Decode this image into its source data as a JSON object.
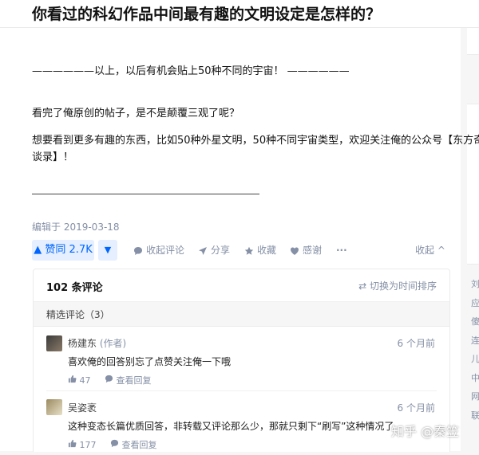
{
  "question": {
    "title": "你看过的科幻作品中间最有趣的文明设定是怎样的？"
  },
  "answer": {
    "line_divider": "——————以上，以后有机会贴上50种不同的宇宙！ ——————",
    "para1": "看完了俺原创的帖子，是不是颠覆三观了呢？",
    "para2_line1": "想要看到更多有趣的东西，比如50种外星文明，50种不同宇宙类型，欢迎关注俺的公众号【东方奇",
    "para2_line2": "谈录】！",
    "edit_date": "编辑于 2019-03-18"
  },
  "actions": {
    "upvote": "▲ 赞同 2.7K",
    "downvote": "▼",
    "comment": "收起评论",
    "share": "分享",
    "favorite": "收藏",
    "thanks": "感谢",
    "more": "···",
    "collapse": "收起 ^"
  },
  "comments": {
    "count_title": "102 条评论",
    "sort_toggle": "⇄ 切换为时间排序",
    "featured": "精选评论（3）",
    "items": [
      {
        "name": "杨建东",
        "tag": " (作者)",
        "time": "6 个月前",
        "body": "喜欢俺的回答别忘了点赞关注俺一下哦",
        "likes": "47",
        "reply": "查看回复"
      },
      {
        "name": "吴姿袤",
        "tag": "",
        "time": "6 个月前",
        "body": "这种变态长篇优质回答，非转载又评论那么少，那就只剩下“刷写”这种情况了",
        "likes": "177",
        "reply": "查看回复"
      }
    ]
  },
  "sidebar_right": {
    "items": [
      "刘",
      "应",
      "傻",
      "连",
      "儿",
      "中",
      "网",
      "联"
    ]
  },
  "watermark": "知乎 @秦笠"
}
